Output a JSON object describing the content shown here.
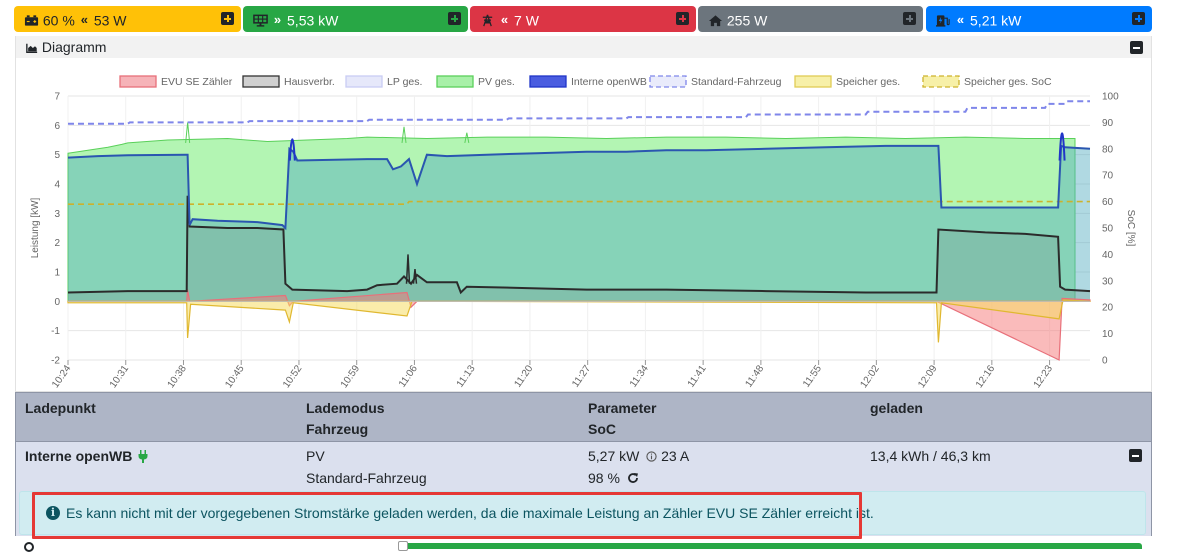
{
  "status_bar": {
    "battery": {
      "text": "60 % ",
      "arrows": "«",
      "value": "53 W",
      "icon": "car-battery-icon"
    },
    "pv": {
      "arrows": "»",
      "value": "5,53 kW",
      "icon": "solar-panel-icon"
    },
    "grid": {
      "arrows": "«",
      "value": "7 W",
      "icon": "power-pylon-icon"
    },
    "house": {
      "value": "255 W",
      "icon": "home-icon"
    },
    "charging": {
      "arrows": "«",
      "value": "5,21 kW",
      "icon": "charging-station-icon"
    }
  },
  "chart_card": {
    "title": "Diagramm",
    "icon": "area-chart-icon"
  },
  "chart_data": {
    "type": "area",
    "ylabel": "Leistung [kW]",
    "y2label": "SoC [%]",
    "ylim": [
      -2,
      7
    ],
    "y2lim": [
      0,
      100
    ],
    "yticks": [
      "7",
      "6",
      "5",
      "4",
      "3",
      "2",
      "1",
      "0",
      "-1",
      "-2"
    ],
    "y2ticks": [
      "100",
      "90",
      "80",
      "70",
      "60",
      "50",
      "40",
      "30",
      "20",
      "10",
      "0"
    ],
    "xticks": [
      "10:24",
      "10:31",
      "10:38",
      "10:45",
      "10:52",
      "10:59",
      "11:06",
      "11:13",
      "11:20",
      "11:27",
      "11:34",
      "11:41",
      "11:48",
      "11:55",
      "12:02",
      "12:09",
      "12:16",
      "12:23"
    ],
    "legend": [
      {
        "name": "EVU SE Zähler",
        "color": "#e8707a",
        "fill": "#f6b3b8",
        "dashed": false
      },
      {
        "name": "Hausverbr.",
        "color": "#333333",
        "fill": "#d0d0d0",
        "dashed": false
      },
      {
        "name": "LP ges.",
        "color": "#c9cdf3",
        "fill": "#e6e8fa",
        "dashed": false
      },
      {
        "name": "PV ges.",
        "color": "#5ad05a",
        "fill": "#a8f0a8",
        "dashed": false
      },
      {
        "name": "Interne openWB",
        "color": "#2035c8",
        "fill": "#4a5de0",
        "dashed": false
      },
      {
        "name": "Standard-Fahrzeug",
        "color": "#7f86ea",
        "fill": "#e9ebfb",
        "dashed": true
      },
      {
        "name": "Speicher ges.",
        "color": "#e0cc55",
        "fill": "#f7f0a8",
        "dashed": false
      },
      {
        "name": "Speicher ges. SoC",
        "color": "#cdb22c",
        "fill": "#f7f0a8",
        "dashed": true
      }
    ],
    "series": [
      {
        "name": "PV ges.",
        "axis": "kW",
        "points": [
          [
            0,
            5.05
          ],
          [
            20,
            5.15
          ],
          [
            40,
            5.25
          ],
          [
            54,
            5.35
          ],
          [
            60,
            5.4
          ],
          [
            100,
            5.5
          ],
          [
            160,
            5.55
          ],
          [
            200,
            5.45
          ],
          [
            240,
            5.5
          ],
          [
            280,
            5.55
          ],
          [
            300,
            5.6
          ],
          [
            360,
            5.55
          ],
          [
            420,
            5.6
          ],
          [
            480,
            5.6
          ],
          [
            540,
            5.55
          ],
          [
            600,
            5.6
          ],
          [
            660,
            5.6
          ],
          [
            720,
            5.55
          ],
          [
            780,
            5.6
          ],
          [
            840,
            5.55
          ],
          [
            900,
            5.6
          ],
          [
            960,
            5.55
          ],
          [
            1010,
            5.55
          ]
        ],
        "spikes": [
          [
            120,
            6.1
          ],
          [
            337,
            5.95
          ],
          [
            400,
            5.75
          ]
        ]
      },
      {
        "name": "Interne openWB",
        "axis": "kW",
        "points": [
          [
            0,
            4.9
          ],
          [
            30,
            4.95
          ],
          [
            60,
            4.98
          ],
          [
            118,
            5.0
          ],
          [
            120,
            5.0
          ],
          [
            122,
            2.6
          ],
          [
            125,
            2.8
          ],
          [
            150,
            2.75
          ],
          [
            190,
            2.7
          ],
          [
            215,
            2.6
          ],
          [
            218,
            2.5
          ],
          [
            222,
            5.2
          ],
          [
            226,
            5.1
          ],
          [
            230,
            4.8
          ],
          [
            300,
            4.85
          ],
          [
            320,
            4.85
          ],
          [
            326,
            4.5
          ],
          [
            334,
            4.6
          ],
          [
            342,
            4.85
          ],
          [
            350,
            4.0
          ],
          [
            360,
            5.0
          ],
          [
            380,
            4.95
          ],
          [
            420,
            5.0
          ],
          [
            470,
            5.05
          ],
          [
            520,
            5.1
          ],
          [
            560,
            5.1
          ],
          [
            600,
            5.15
          ],
          [
            640,
            5.15
          ],
          [
            700,
            5.2
          ],
          [
            760,
            5.25
          ],
          [
            820,
            5.3
          ],
          [
            873,
            5.3
          ],
          [
            876,
            3.2
          ],
          [
            920,
            3.2
          ],
          [
            960,
            3.2
          ],
          [
            993,
            3.2
          ],
          [
            996,
            5.3
          ],
          [
            1000,
            5.25
          ],
          [
            1025,
            5.2
          ]
        ],
        "spikes": [
          [
            225,
            5.95
          ],
          [
            997,
            6.35
          ]
        ]
      },
      {
        "name": "Hausverbr.",
        "axis": "kW",
        "points": [
          [
            0,
            0.3
          ],
          [
            60,
            0.35
          ],
          [
            119,
            0.35
          ],
          [
            120,
            3.6
          ],
          [
            122,
            2.55
          ],
          [
            160,
            2.5
          ],
          [
            190,
            2.5
          ],
          [
            216,
            2.45
          ],
          [
            218,
            0.6
          ],
          [
            225,
            0.4
          ],
          [
            280,
            0.35
          ],
          [
            300,
            0.4
          ],
          [
            310,
            0.55
          ],
          [
            330,
            0.6
          ],
          [
            337,
            0.85
          ],
          [
            344,
            0.6
          ],
          [
            350,
            0.9
          ],
          [
            360,
            0.65
          ],
          [
            390,
            0.65
          ],
          [
            394,
            0.3
          ],
          [
            400,
            0.5
          ],
          [
            460,
            0.45
          ],
          [
            520,
            0.4
          ],
          [
            600,
            0.4
          ],
          [
            700,
            0.35
          ],
          [
            800,
            0.3
          ],
          [
            871,
            0.3
          ],
          [
            873,
            2.45
          ],
          [
            920,
            2.35
          ],
          [
            960,
            2.3
          ],
          [
            993,
            2.2
          ],
          [
            995,
            0.5
          ],
          [
            1000,
            0.4
          ],
          [
            1025,
            0.35
          ]
        ],
        "spikes": [
          [
            341,
            1.6
          ],
          [
            348,
            1.1
          ]
        ]
      },
      {
        "name": "EVU SE Zähler",
        "axis": "kW",
        "points": [
          [
            0,
            0.0
          ],
          [
            119,
            0.0
          ],
          [
            120,
            0.4
          ],
          [
            122,
            0.0
          ],
          [
            218,
            0.2
          ],
          [
            222,
            -0.15
          ],
          [
            226,
            0.0
          ],
          [
            340,
            0.3
          ],
          [
            344,
            -0.2
          ],
          [
            350,
            0.0
          ],
          [
            871,
            0.0
          ],
          [
            994,
            -2.0
          ],
          [
            997,
            0.1
          ],
          [
            1025,
            0.05
          ]
        ]
      },
      {
        "name": "Speicher ges.",
        "axis": "kW",
        "points": [
          [
            0,
            -0.05
          ],
          [
            119,
            -0.05
          ],
          [
            120,
            -1.25
          ],
          [
            123,
            -0.1
          ],
          [
            218,
            -0.3
          ],
          [
            222,
            -0.7
          ],
          [
            226,
            -0.05
          ],
          [
            340,
            -0.5
          ],
          [
            345,
            0.0
          ],
          [
            871,
            -0.05
          ],
          [
            873,
            -1.4
          ],
          [
            876,
            -0.05
          ],
          [
            994,
            -0.6
          ],
          [
            998,
            0.05
          ],
          [
            1025,
            0.0
          ]
        ]
      },
      {
        "name": "Standard-Fahrzeug",
        "axis": "SoC",
        "points": [
          [
            0,
            89.5
          ],
          [
            60,
            89.5
          ],
          [
            62,
            90.0
          ],
          [
            180,
            90.0
          ],
          [
            182,
            90.5
          ],
          [
            300,
            90.5
          ],
          [
            302,
            91.0
          ],
          [
            440,
            91.0
          ],
          [
            442,
            91.5
          ],
          [
            560,
            91.5
          ],
          [
            562,
            92.0
          ],
          [
            680,
            92.0
          ],
          [
            682,
            93.0
          ],
          [
            800,
            93.0
          ],
          [
            802,
            94.0
          ],
          [
            900,
            94.0
          ],
          [
            902,
            95.5
          ],
          [
            980,
            95.5
          ],
          [
            982,
            97.0
          ],
          [
            1000,
            97.0
          ],
          [
            1002,
            98.0
          ],
          [
            1025,
            98.0
          ]
        ]
      },
      {
        "name": "Speicher ges. SoC",
        "axis": "SoC",
        "points": [
          [
            0,
            59.0
          ],
          [
            340,
            59.0
          ],
          [
            342,
            60.0
          ],
          [
            1025,
            60.0
          ]
        ]
      }
    ]
  },
  "lp_table": {
    "headers": {
      "ladepunkt": "Ladepunkt",
      "lademodus": "Lademodus",
      "fahrzeug": "Fahrzeug",
      "parameter": "Parameter",
      "soc": "SoC",
      "geladen": "geladen"
    },
    "row": {
      "name": "Interne openWB",
      "plug_icon": "plug-icon",
      "mode": "PV",
      "vehicle": "Standard-Fahrzeug",
      "power": "5,27 kW",
      "current": "23 A",
      "current_icon": "info-circle-icon",
      "soc": "98 %",
      "refresh_icon": "refresh-icon",
      "charged": "13,4 kWh / 46,3 km"
    },
    "alert": {
      "text": "Es kann nicht mit der vorgegebenen Stromstärke geladen werden, da die maximale Leistung an Zähler EVU SE Zähler erreicht ist.",
      "icon": "info-circle-icon"
    }
  }
}
